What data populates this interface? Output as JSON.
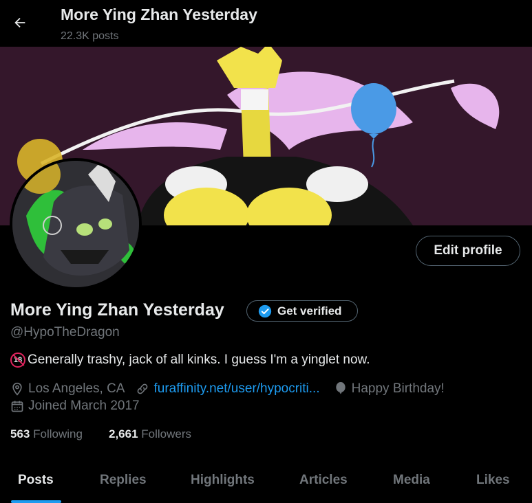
{
  "header": {
    "title": "More Ying Zhan Yesterday",
    "post_count": "22.3K posts"
  },
  "profile": {
    "edit_label": "Edit profile",
    "display_name": "More Ying Zhan Yesterday",
    "verify_label": "Get verified",
    "handle": "@HypoTheDragon",
    "bio_badge": "18",
    "bio": "Generally trashy, jack of all kinks. I guess I'm a yinglet now.",
    "location": "Los Angeles, CA",
    "website": "furaffinity.net/user/hypocriti...",
    "birthday": "Happy Birthday!",
    "joined": "Joined March 2017"
  },
  "stats": {
    "following_count": "563",
    "following_label": "Following",
    "followers_count": "2,661",
    "followers_label": "Followers"
  },
  "tabs": [
    {
      "label": "Posts"
    },
    {
      "label": "Replies"
    },
    {
      "label": "Highlights"
    },
    {
      "label": "Articles"
    },
    {
      "label": "Media"
    },
    {
      "label": "Likes"
    }
  ],
  "colors": {
    "accent": "#1d9bf0",
    "banner_bg": "#34172b",
    "text_secondary": "#71767b"
  }
}
